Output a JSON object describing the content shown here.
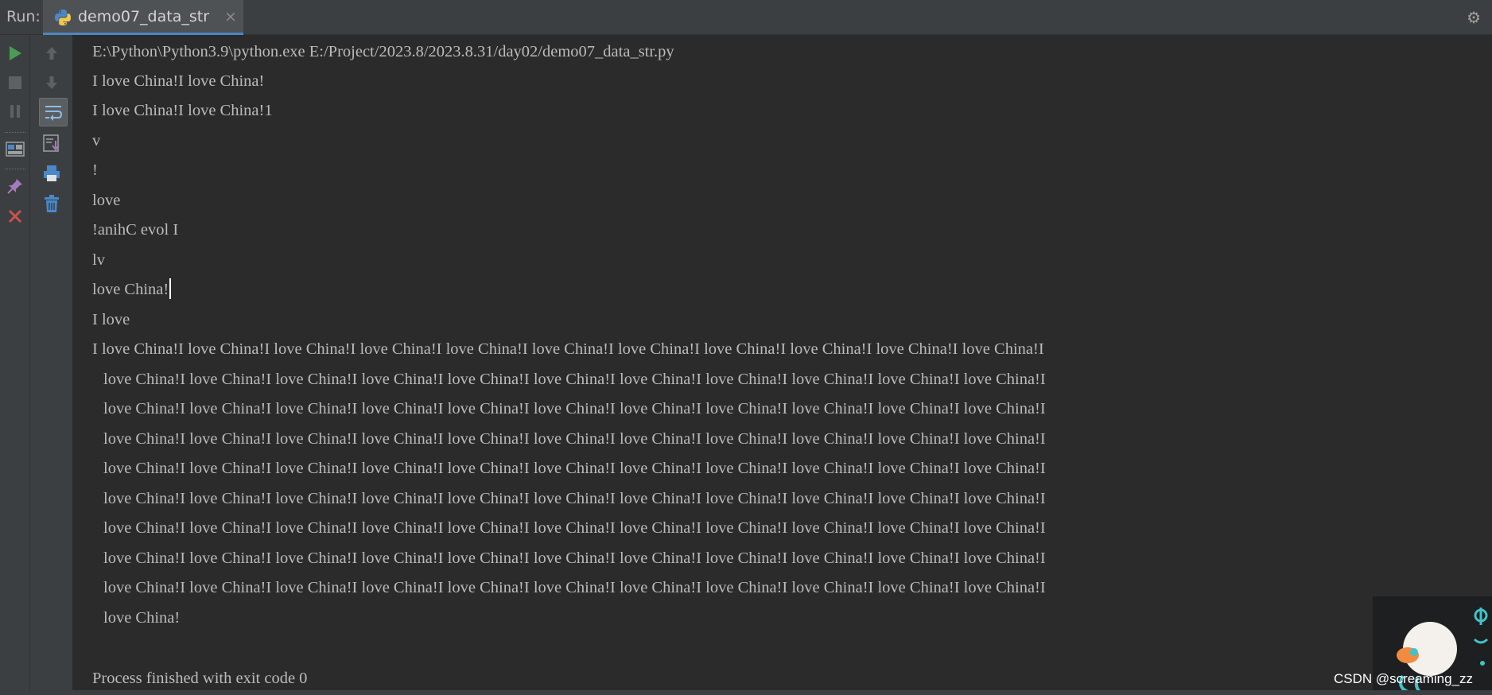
{
  "run_panel": {
    "label": "Run:",
    "tab_title": "demo07_data_str",
    "close_glyph": "×",
    "settings_glyph": "⚙"
  },
  "toolbar": {
    "icons": [
      "rerun-icon",
      "stop-icon",
      "pause-icon",
      "layout-icon",
      "pin-icon",
      "close-icon",
      "up-arrow-icon",
      "down-arrow-icon",
      "soft-wrap-icon",
      "scroll-to-end-icon",
      "print-icon",
      "trash-icon"
    ]
  },
  "console": {
    "command": "E:\\Python\\Python3.9\\python.exe E:/Project/2023.8/2023.8.31/day02/demo07_data_str.py",
    "out": [
      "I love China!I love China!",
      "I love China!I love China!1",
      "v",
      "!",
      "love",
      "!anihC evol I",
      "lv",
      "love China!",
      "I love"
    ],
    "repeat_first": "I love China!I love China!I love China!I love China!I love China!I love China!I love China!I love China!I love China!I love China!I love China!I",
    "repeat_line": "love China!I love China!I love China!I love China!I love China!I love China!I love China!I love China!I love China!I love China!I love China!I",
    "repeat_last": "love China!",
    "finished": "Process finished with exit code 0"
  },
  "watermark": "CSDN @screaming_zz",
  "colors": {
    "background": "#2b2b2b",
    "toolbar": "#3c3f41",
    "text": "#bbbbbb",
    "run_green": "#499c54",
    "stop_red": "#c75450",
    "accent_blue": "#4a88c7"
  }
}
